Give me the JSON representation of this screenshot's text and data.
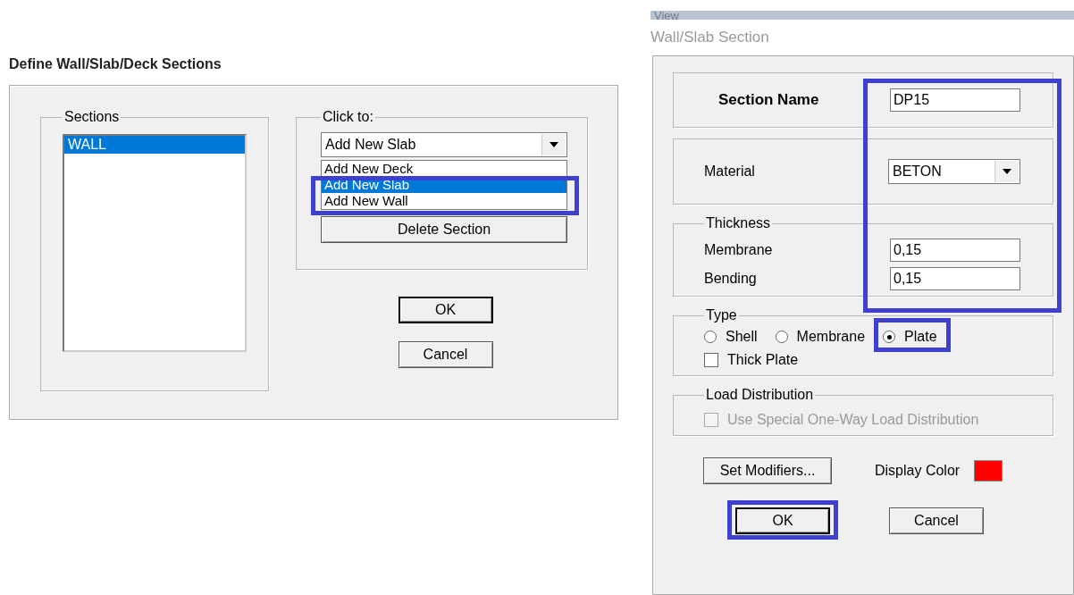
{
  "left_dialog": {
    "title": "Define Wall/Slab/Deck Sections",
    "sections": {
      "label": "Sections",
      "items": [
        {
          "label": "WALL",
          "selected": true
        }
      ]
    },
    "click_to": {
      "label": "Click to:",
      "dropdown_value": "Add New Slab",
      "options": [
        {
          "label": "Add New Deck",
          "selected": false
        },
        {
          "label": "Add New Slab",
          "selected": true
        },
        {
          "label": "Add New Wall",
          "selected": false
        }
      ],
      "delete_button": "Delete Section"
    },
    "buttons": [
      "OK",
      "Cancel"
    ]
  },
  "right_dialog": {
    "menu_fragment": "View",
    "title": "Wall/Slab Section",
    "section_name": {
      "label": "Section Name",
      "value": "DP15"
    },
    "material": {
      "label": "Material",
      "value": "BETON"
    },
    "thickness": {
      "label": "Thickness",
      "fields": [
        {
          "label": "Membrane",
          "value": "0,15"
        },
        {
          "label": "Bending",
          "value": "0,15"
        }
      ]
    },
    "type": {
      "label": "Type",
      "options": [
        {
          "label": "Shell",
          "selected": false
        },
        {
          "label": "Membrane",
          "selected": false
        },
        {
          "label": "Plate",
          "selected": true
        }
      ],
      "thick_plate": {
        "label": "Thick Plate",
        "checked": false
      }
    },
    "load_distribution": {
      "label": "Load Distribution",
      "option": {
        "label": "Use Special One-Way Load Distribution",
        "checked": false,
        "disabled": true
      }
    },
    "set_modifiers": "Set Modifiers...",
    "display_color": {
      "label": "Display Color",
      "color": "#ff0000"
    },
    "buttons": [
      "OK",
      "Cancel"
    ]
  }
}
